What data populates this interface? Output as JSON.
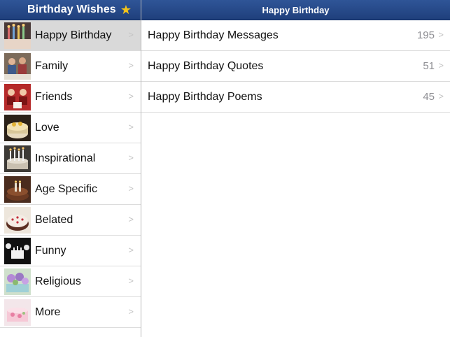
{
  "sidebar": {
    "title": "Birthday Wishes",
    "star_icon": "star-icon",
    "accent": "#f5c518",
    "items": [
      {
        "label": "Happy Birthday",
        "thumb": "birthday-candles-image",
        "selected": true
      },
      {
        "label": "Family",
        "thumb": "family-photo-image"
      },
      {
        "label": "Friends",
        "thumb": "friends-photo-image"
      },
      {
        "label": "Love",
        "thumb": "love-cake-image"
      },
      {
        "label": "Inspirational",
        "thumb": "candles-cake-image"
      },
      {
        "label": "Age Specific",
        "thumb": "age-cake-image"
      },
      {
        "label": "Belated",
        "thumb": "belated-cake-image"
      },
      {
        "label": "Funny",
        "thumb": "funny-cartoon-image"
      },
      {
        "label": "Religious",
        "thumb": "flower-cake-image"
      },
      {
        "label": "More",
        "thumb": "pink-cake-image"
      }
    ]
  },
  "detail": {
    "title": "Happy Birthday",
    "items": [
      {
        "label": "Happy Birthday Messages",
        "count": "195"
      },
      {
        "label": "Happy Birthday Quotes",
        "count": "51"
      },
      {
        "label": "Happy Birthday Poems",
        "count": "45"
      }
    ]
  },
  "colors": {
    "navbar": "#2a4e8f",
    "selected_row": "#d9d9d9",
    "count_text": "#8e8e93"
  }
}
